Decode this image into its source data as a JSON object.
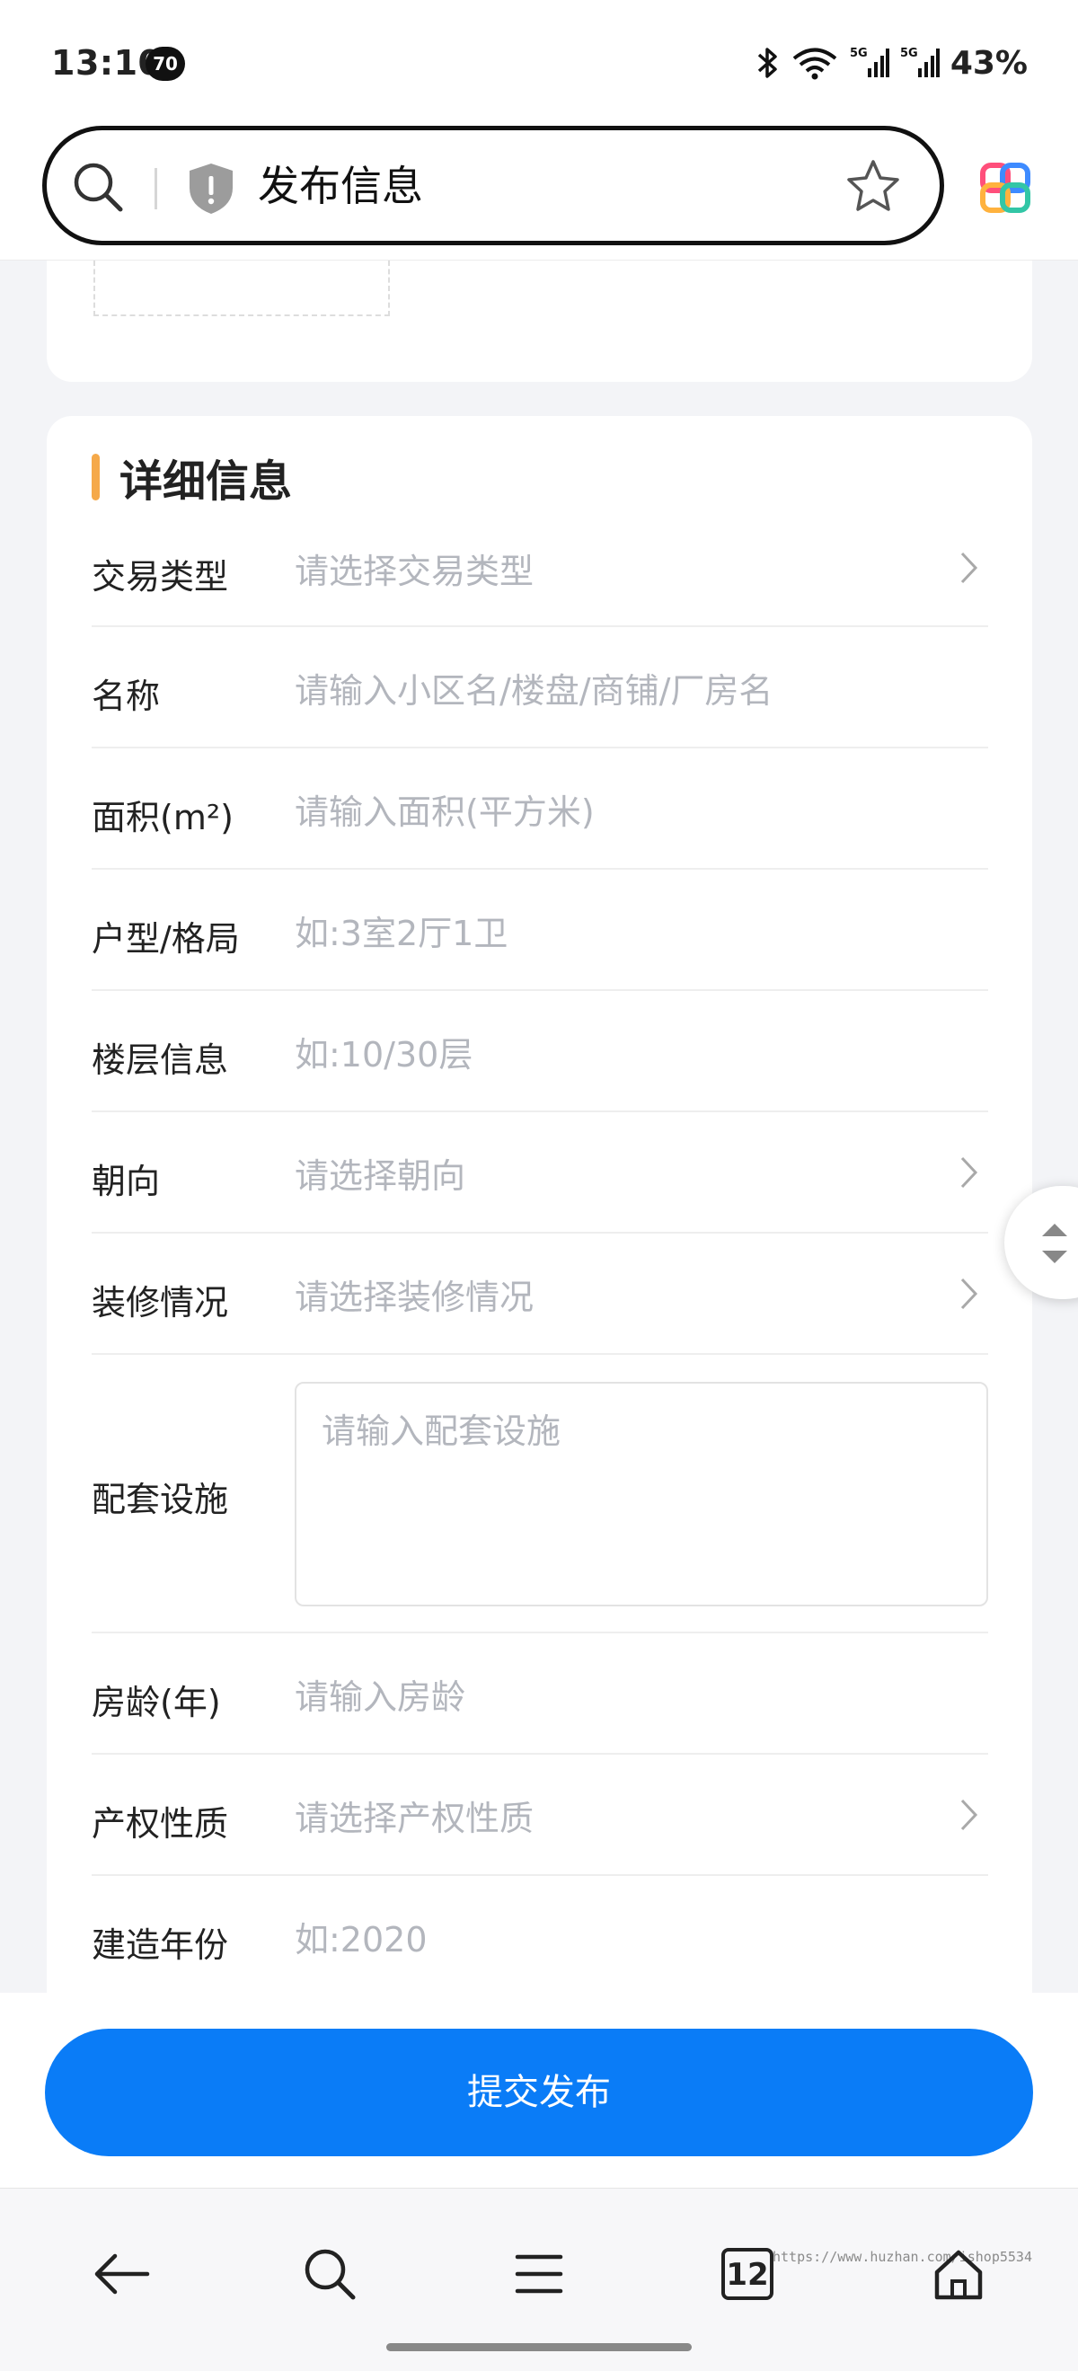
{
  "status_bar": {
    "time": "13:10",
    "notification_badge": "70",
    "battery": "43%",
    "icons": [
      "bluetooth-icon",
      "wifi-icon",
      "signal-5g-icon",
      "signal-5g-icon",
      "battery-text"
    ]
  },
  "browser": {
    "page_title": "发布信息",
    "icons": [
      "search-icon",
      "shield-warning-icon",
      "star-icon",
      "app-logo-icon"
    ]
  },
  "detail_section": {
    "title": "详细信息",
    "accent_color": "#f5a94a",
    "fields": [
      {
        "label": "交易类型",
        "placeholder": "请选择交易类型",
        "type": "select"
      },
      {
        "label": "名称",
        "placeholder": "请输入小区名/楼盘/商铺/厂房名",
        "type": "input"
      },
      {
        "label": "面积(m²)",
        "placeholder": "请输入面积(平方米)",
        "type": "input"
      },
      {
        "label": "户型/格局",
        "placeholder": "如:3室2厅1卫",
        "type": "input"
      },
      {
        "label": "楼层信息",
        "placeholder": "如:10/30层",
        "type": "input"
      },
      {
        "label": "朝向",
        "placeholder": "请选择朝向",
        "type": "select"
      },
      {
        "label": "装修情况",
        "placeholder": "请选择装修情况",
        "type": "select"
      },
      {
        "label": "配套设施",
        "placeholder": "请输入配套设施",
        "type": "textarea"
      },
      {
        "label": "房龄(年)",
        "placeholder": "请输入房龄",
        "type": "input"
      },
      {
        "label": "产权性质",
        "placeholder": "请选择产权性质",
        "type": "select"
      },
      {
        "label": "建造年份",
        "placeholder": "如:2020",
        "type": "input"
      }
    ]
  },
  "submit": {
    "label": "提交发布",
    "color": "#0a7cf7"
  },
  "bottom_nav": {
    "tab_count": "12",
    "watermark": "https://www.huzhan.com/ishop5534",
    "icons": [
      "back-arrow-icon",
      "search-icon",
      "menu-icon",
      "tabs-icon",
      "home-icon"
    ]
  }
}
